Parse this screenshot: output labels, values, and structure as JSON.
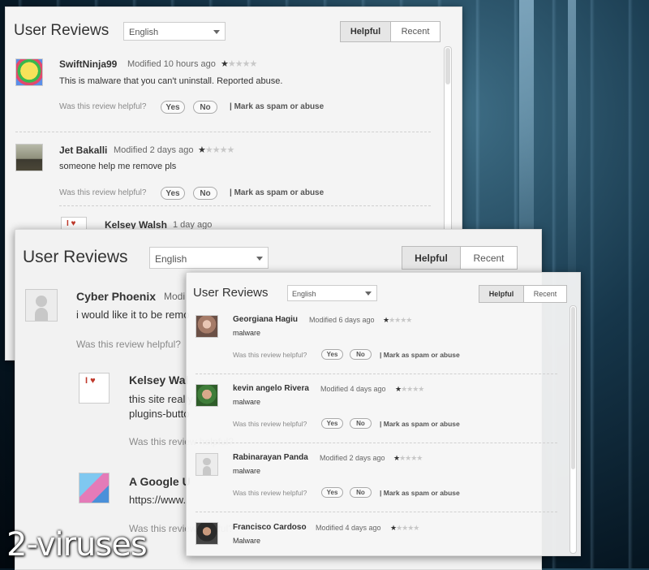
{
  "panel1": {
    "title": "User Reviews",
    "language": "English",
    "sort_helpful": "Helpful",
    "sort_recent": "Recent",
    "reviews": [
      {
        "name": "SwiftNinja99",
        "meta": "Modified 10 hours ago",
        "text": "This is malware that you can't uninstall. Reported abuse.",
        "rating": 1
      },
      {
        "name": "Jet Bakalli",
        "meta": "Modified 2 days ago",
        "text": "someone help me remove pls",
        "rating": 1
      },
      {
        "name": "Kelsey Walsh",
        "meta": "1 day ago"
      }
    ]
  },
  "panel2": {
    "title": "User Reviews",
    "language": "English",
    "sort_helpful": "Helpful",
    "sort_recent": "Recent",
    "reviews": [
      {
        "name": "Cyber Phoenix",
        "meta": "Modi",
        "text": "i would like it to be remo"
      },
      {
        "name": "Kelsey Wal",
        "text": "this site really",
        "text2": "plugins-butto"
      },
      {
        "name": "A Google U",
        "text": "https://www."
      }
    ]
  },
  "panel3": {
    "title": "User Reviews",
    "language": "English",
    "sort_helpful": "Helpful",
    "sort_recent": "Recent",
    "reviews": [
      {
        "name": "Georgiana Hagiu",
        "meta": "Modified 6 days ago",
        "text": "malware",
        "rating": 1
      },
      {
        "name": "kevin angelo Rivera",
        "meta": "Modified 4 days ago",
        "text": "malware",
        "rating": 1
      },
      {
        "name": "Rabinarayan Panda",
        "meta": "Modified 2 days ago",
        "text": "malware",
        "rating": 1
      },
      {
        "name": "Francisco Cardoso",
        "meta": "Modified 4 days ago",
        "text": "Malware",
        "rating": 1
      }
    ]
  },
  "common": {
    "helpful_question": "Was this review helpful?",
    "yes": "Yes",
    "no": "No",
    "spam": "| Mark as spam or abuse",
    "star_on": "★",
    "star_off": "★★★★"
  },
  "watermark": "2-viruses"
}
